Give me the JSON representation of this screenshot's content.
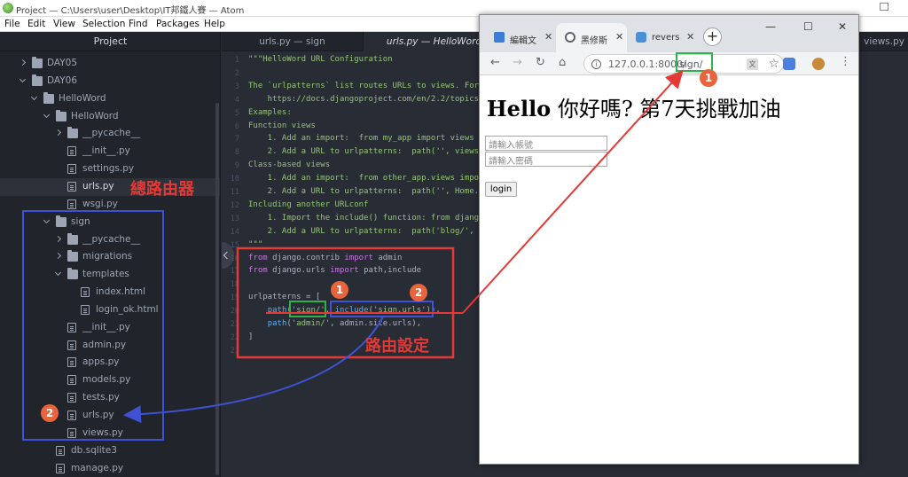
{
  "window": {
    "title": "Project — C:\\Users\\user\\Desktop\\IT邦鐵人賽 — Atom"
  },
  "menu": [
    "File",
    "Edit",
    "View",
    "Selection",
    "Find",
    "Packages",
    "Help"
  ],
  "tree": {
    "header": "Project",
    "rows": [
      {
        "label": "DAY05",
        "kind": "folder",
        "state": "collapsed",
        "depth": 0
      },
      {
        "label": "DAY06",
        "kind": "folder",
        "state": "expanded",
        "depth": 0
      },
      {
        "label": "HelloWord",
        "kind": "folder",
        "state": "expanded",
        "depth": 1
      },
      {
        "label": "HelloWord",
        "kind": "folder",
        "state": "expanded",
        "depth": 2
      },
      {
        "label": "__pycache__",
        "kind": "folder",
        "state": "collapsed",
        "depth": 3
      },
      {
        "label": "__init__.py",
        "kind": "file",
        "depth": 3
      },
      {
        "label": "settings.py",
        "kind": "file",
        "depth": 3
      },
      {
        "label": "urls.py",
        "kind": "file",
        "depth": 3,
        "selected": true
      },
      {
        "label": "wsgi.py",
        "kind": "file",
        "depth": 3
      },
      {
        "label": "sign",
        "kind": "folder",
        "state": "expanded",
        "depth": 2
      },
      {
        "label": "__pycache__",
        "kind": "folder",
        "state": "collapsed",
        "depth": 3
      },
      {
        "label": "migrations",
        "kind": "folder",
        "state": "collapsed",
        "depth": 3
      },
      {
        "label": "templates",
        "kind": "folder",
        "state": "expanded",
        "depth": 3
      },
      {
        "label": "index.html",
        "kind": "file",
        "depth": 4
      },
      {
        "label": "login_ok.html",
        "kind": "file",
        "depth": 4
      },
      {
        "label": "__init__.py",
        "kind": "file",
        "depth": 3
      },
      {
        "label": "admin.py",
        "kind": "file",
        "depth": 3
      },
      {
        "label": "apps.py",
        "kind": "file",
        "depth": 3
      },
      {
        "label": "models.py",
        "kind": "file",
        "depth": 3
      },
      {
        "label": "tests.py",
        "kind": "file",
        "depth": 3
      },
      {
        "label": "urls.py",
        "kind": "file",
        "depth": 3
      },
      {
        "label": "views.py",
        "kind": "file",
        "depth": 3
      },
      {
        "label": "db.sqlite3",
        "kind": "file",
        "depth": 2
      },
      {
        "label": "manage.py",
        "kind": "file",
        "depth": 2
      }
    ]
  },
  "editor": {
    "tabs": [
      {
        "label": "urls.py — sign",
        "active": false
      },
      {
        "label": "urls.py — HelloWord",
        "active": true
      },
      {
        "label": "views.py",
        "active": false
      }
    ],
    "lines": [
      {
        "n": "1",
        "segs": [
          {
            "t": "\"\"\"HelloWord URL Configuration",
            "c": "c-green"
          }
        ]
      },
      {
        "n": "2",
        "segs": []
      },
      {
        "n": "3",
        "segs": [
          {
            "t": "The `urlpatterns` list routes URLs to views. For",
            "c": "c-green"
          }
        ]
      },
      {
        "n": "4",
        "segs": [
          {
            "t": "    https://docs.djangoproject.com/en/2.2/topics",
            "c": "c-green"
          }
        ]
      },
      {
        "n": "5",
        "segs": [
          {
            "t": "Examples:",
            "c": "c-green"
          }
        ]
      },
      {
        "n": "6",
        "segs": [
          {
            "t": "Function views",
            "c": "c-green"
          }
        ]
      },
      {
        "n": "7",
        "segs": [
          {
            "t": "    1. Add an import:  from my_app import views",
            "c": "c-green"
          }
        ]
      },
      {
        "n": "8",
        "segs": [
          {
            "t": "    2. Add a URL to urlpatterns:  path('', views",
            "c": "c-green"
          }
        ]
      },
      {
        "n": "9",
        "segs": [
          {
            "t": "Class-based views",
            "c": "c-green"
          }
        ]
      },
      {
        "n": "10",
        "segs": [
          {
            "t": "    1. Add an import:  from other_app.views impo",
            "c": "c-green"
          }
        ]
      },
      {
        "n": "11",
        "segs": [
          {
            "t": "    2. Add a URL to urlpatterns:  path('', Home.",
            "c": "c-green"
          }
        ]
      },
      {
        "n": "12",
        "segs": [
          {
            "t": "Including another URLconf",
            "c": "c-green"
          }
        ]
      },
      {
        "n": "13",
        "segs": [
          {
            "t": "    1. Import the include() function: from djang",
            "c": "c-green"
          }
        ]
      },
      {
        "n": "14",
        "segs": [
          {
            "t": "    2. Add a URL to urlpatterns:  path('blog/', ",
            "c": "c-green"
          }
        ]
      },
      {
        "n": "15",
        "segs": [
          {
            "t": "\"\"\"",
            "c": "c-green"
          }
        ]
      },
      {
        "n": "16",
        "segs": [
          {
            "t": "from",
            "c": "c-kw"
          },
          {
            "t": " django.contrib ",
            "c": "c-plain"
          },
          {
            "t": "import",
            "c": "c-kw"
          },
          {
            "t": " admin",
            "c": "c-plain"
          }
        ]
      },
      {
        "n": "17",
        "segs": [
          {
            "t": "from",
            "c": "c-kw"
          },
          {
            "t": " django.urls ",
            "c": "c-plain"
          },
          {
            "t": "import",
            "c": "c-kw"
          },
          {
            "t": " path,include",
            "c": "c-plain"
          }
        ]
      },
      {
        "n": "18",
        "segs": []
      },
      {
        "n": "19",
        "segs": [
          {
            "t": "urlpatterns = [",
            "c": "c-plain"
          }
        ]
      },
      {
        "n": "20",
        "segs": [
          {
            "t": "    ",
            "c": "c-plain"
          },
          {
            "t": "path",
            "c": "c-fn"
          },
          {
            "t": "(",
            "c": "c-plain"
          },
          {
            "t": "'sign/'",
            "c": "c-str"
          },
          {
            "t": ", ",
            "c": "c-plain"
          },
          {
            "t": "include",
            "c": "c-fn"
          },
          {
            "t": "(",
            "c": "c-plain"
          },
          {
            "t": "'sign.urls'",
            "c": "c-str"
          },
          {
            "t": ")),",
            "c": "c-plain"
          }
        ]
      },
      {
        "n": "21",
        "segs": [
          {
            "t": "    ",
            "c": "c-plain"
          },
          {
            "t": "path",
            "c": "c-fn"
          },
          {
            "t": "(",
            "c": "c-plain"
          },
          {
            "t": "'admin/'",
            "c": "c-str"
          },
          {
            "t": ", admin.site.urls),",
            "c": "c-plain"
          }
        ]
      },
      {
        "n": "22",
        "segs": [
          {
            "t": "]",
            "c": "c-plain"
          }
        ]
      },
      {
        "n": "23",
        "segs": []
      }
    ]
  },
  "browser": {
    "tabs": [
      {
        "label": "編輯文",
        "favicon_color": "#3b7dd8",
        "active": false
      },
      {
        "label": "黑修斯",
        "favicon_color": "#5f6368",
        "active": true
      },
      {
        "label": "revers",
        "favicon_color": "#4a90d9",
        "active": false
      }
    ],
    "new_tab": "+",
    "controls": {
      "minimize": "—",
      "maximize": "☐",
      "close": "✕"
    },
    "url_host": "127.0.0.1:8000/",
    "url_path": "sign/",
    "page": {
      "heading_bold": "Hello",
      "heading_cjk": " 你好嗎? 第7天挑戰加油",
      "username_placeholder": "請輸入帳號",
      "password_placeholder": "請輸入密碼",
      "login_label": "login"
    }
  },
  "annotations": {
    "main_router_label": "總路由器",
    "route_setting_label": "路由設定",
    "badge_1": "1",
    "badge_2": "2",
    "colors": {
      "red": "#e53935",
      "green": "#2db34a",
      "blue": "#3f51d4",
      "badge": "#e8643c"
    }
  }
}
